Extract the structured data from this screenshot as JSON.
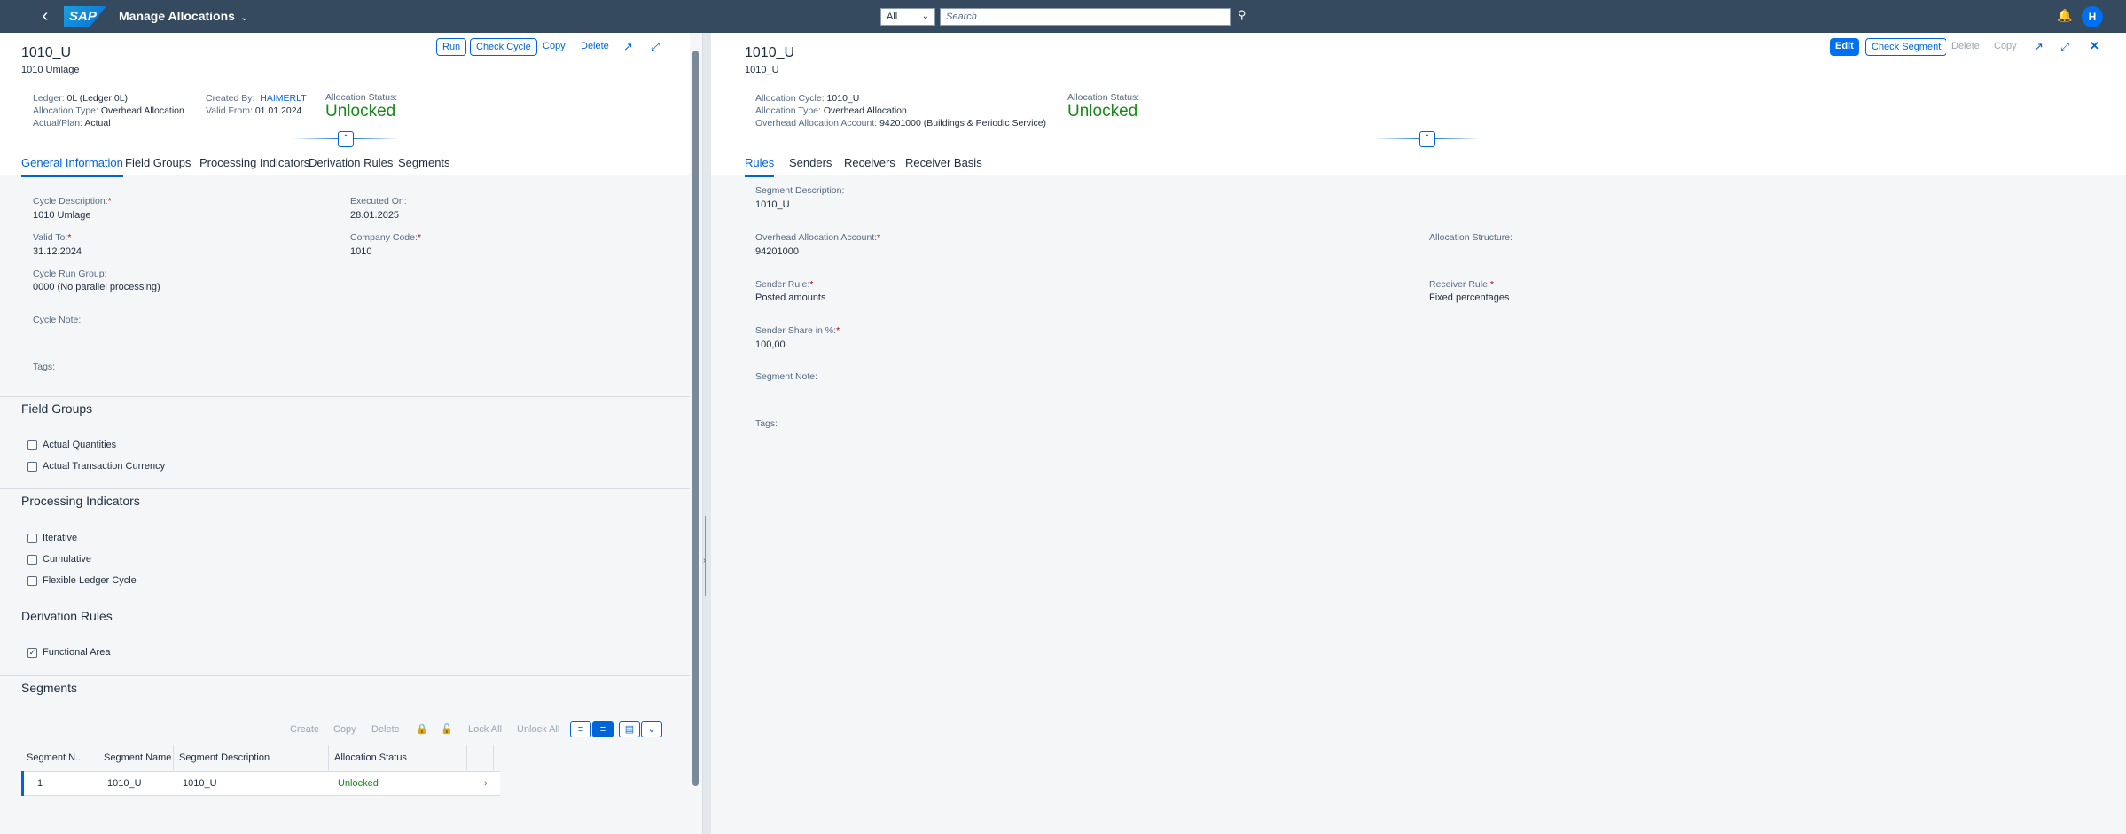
{
  "shell": {
    "app_title": "Manage Allocations",
    "scope": "All",
    "search_placeholder": "Search",
    "avatar_initial": "H"
  },
  "left": {
    "title": "1010_U",
    "subtitle": "1010 Umlage",
    "actions": [
      "Run",
      "Check Cycle",
      "Copy",
      "Delete"
    ],
    "header": {
      "ledger_label": "Ledger:",
      "ledger_value": "0L (Ledger 0L)",
      "alloc_type_label": "Allocation Type:",
      "alloc_type_value": "Overhead Allocation",
      "actual_plan_label": "Actual/Plan:",
      "actual_plan_value": "Actual",
      "created_by_label": "Created By:",
      "created_by_value": "HAIMERLT",
      "valid_from_label": "Valid From:",
      "valid_from_value": "01.01.2024",
      "status_label": "Allocation Status:",
      "status_value": "Unlocked"
    },
    "tabs": [
      "General Information",
      "Field Groups",
      "Processing Indicators",
      "Derivation Rules",
      "Segments"
    ],
    "general": {
      "cycle_desc_label": "Cycle Description:",
      "cycle_desc_value": "1010 Umlage",
      "executed_on_label": "Executed On:",
      "executed_on_value": "28.01.2025",
      "valid_to_label": "Valid To:",
      "valid_to_value": "31.12.2024",
      "company_code_label": "Company Code:",
      "company_code_value": "1010",
      "run_group_label": "Cycle Run Group:",
      "run_group_value": "0000 (No parallel processing)",
      "cycle_note_label": "Cycle Note:",
      "tags_label": "Tags:"
    },
    "field_groups": {
      "title": "Field Groups",
      "items": [
        "Actual Quantities",
        "Actual Transaction Currency"
      ]
    },
    "processing": {
      "title": "Processing Indicators",
      "items": [
        "Iterative",
        "Cumulative",
        "Flexible Ledger Cycle"
      ]
    },
    "derivation": {
      "title": "Derivation Rules",
      "items": [
        "Functional Area"
      ]
    },
    "segments": {
      "title": "Segments",
      "toolbar": [
        "Create",
        "Copy",
        "Delete",
        "Lock All",
        "Unlock All"
      ],
      "columns": [
        "Segment N...",
        "Segment Name",
        "Segment Description",
        "Allocation Status"
      ],
      "rows": [
        {
          "number": "1",
          "name": "1010_U",
          "description": "1010_U",
          "status": "Unlocked"
        }
      ]
    }
  },
  "right": {
    "title": "1010_U",
    "subtitle": "1010_U",
    "actions": [
      "Edit",
      "Check Segment",
      "Delete",
      "Copy"
    ],
    "header": {
      "cycle_label": "Allocation Cycle:",
      "cycle_value": "1010_U",
      "type_label": "Allocation Type:",
      "type_value": "Overhead Allocation",
      "account_label": "Overhead Allocation Account:",
      "account_value": "94201000 (Buildings & Periodic Service)",
      "status_label": "Allocation Status:",
      "status_value": "Unlocked"
    },
    "tabs": [
      "Rules",
      "Senders",
      "Receivers",
      "Receiver Basis"
    ],
    "rules": {
      "seg_desc_label": "Segment Description:",
      "seg_desc_value": "1010_U",
      "oh_account_label": "Overhead Allocation Account:",
      "oh_account_value": "94201000",
      "alloc_structure_label": "Allocation Structure:",
      "sender_rule_label": "Sender Rule:",
      "sender_rule_value": "Posted amounts",
      "receiver_rule_label": "Receiver Rule:",
      "receiver_rule_value": "Fixed percentages",
      "sender_share_label": "Sender Share in %:",
      "sender_share_value": "100,00",
      "seg_note_label": "Segment Note:",
      "tags_label": "Tags:"
    }
  }
}
